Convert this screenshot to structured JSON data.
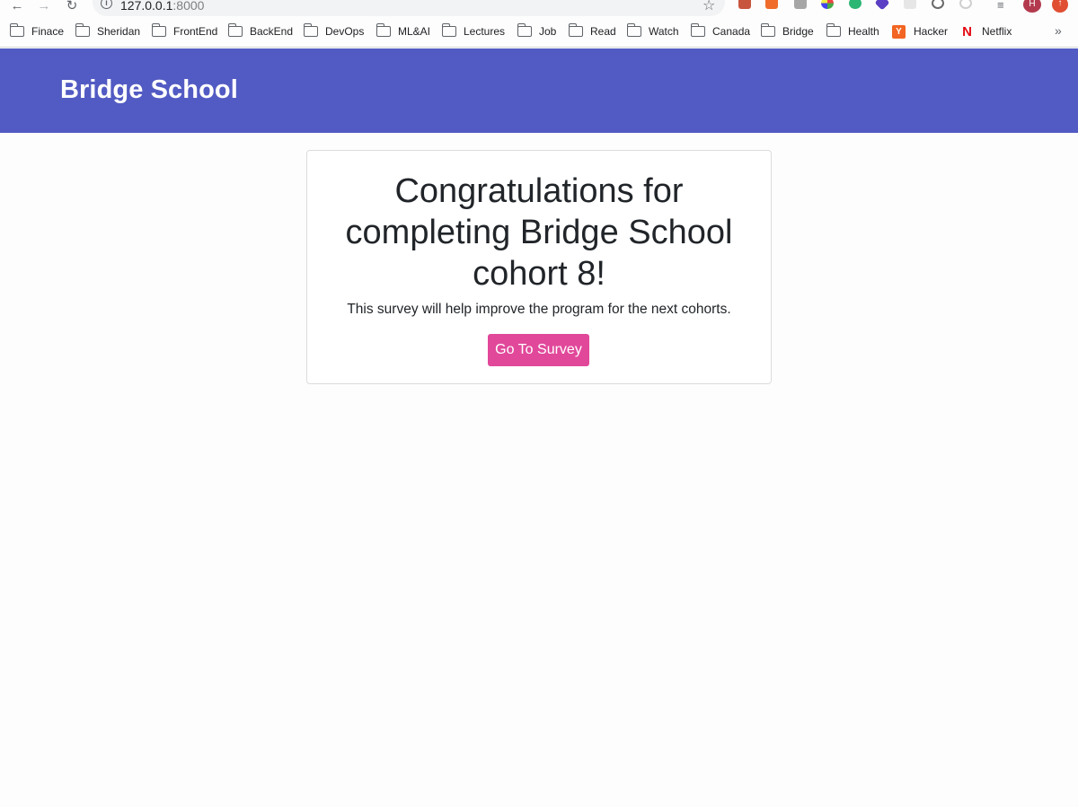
{
  "browser": {
    "url_host": "127.0.0.1",
    "url_port": ":8000",
    "profile_initial": "H",
    "nav": {
      "back_icon": "arrow-left-icon",
      "forward_icon": "arrow-right-icon",
      "reload_icon": "reload-icon"
    }
  },
  "bookmarks": [
    {
      "label": "Finace",
      "icon": "folder-icon"
    },
    {
      "label": "Sheridan",
      "icon": "folder-icon"
    },
    {
      "label": "FrontEnd",
      "icon": "folder-icon"
    },
    {
      "label": "BackEnd",
      "icon": "folder-icon"
    },
    {
      "label": "DevOps",
      "icon": "folder-icon"
    },
    {
      "label": "ML&AI",
      "icon": "folder-icon"
    },
    {
      "label": "Lectures",
      "icon": "folder-icon"
    },
    {
      "label": "Job",
      "icon": "folder-icon"
    },
    {
      "label": "Read",
      "icon": "folder-icon"
    },
    {
      "label": "Watch",
      "icon": "folder-icon"
    },
    {
      "label": "Canada",
      "icon": "folder-icon"
    },
    {
      "label": "Bridge",
      "icon": "folder-icon"
    },
    {
      "label": "Health",
      "icon": "folder-icon"
    },
    {
      "label": "Hacker",
      "icon": "hacker-news-icon",
      "favicon_text": "Y"
    },
    {
      "label": "Netflix",
      "icon": "netflix-icon",
      "favicon_text": "N"
    }
  ],
  "bookmarks_more": "»",
  "header": {
    "brand": "Bridge School"
  },
  "card": {
    "title": "Congratulations for completing Bridge School cohort 8!",
    "text": "This survey will help improve the program for the next cohorts.",
    "button_label": "Go To Survey"
  },
  "colors": {
    "header_bg": "#525bc3",
    "button_bg": "#e1489a",
    "text": "#212529"
  }
}
